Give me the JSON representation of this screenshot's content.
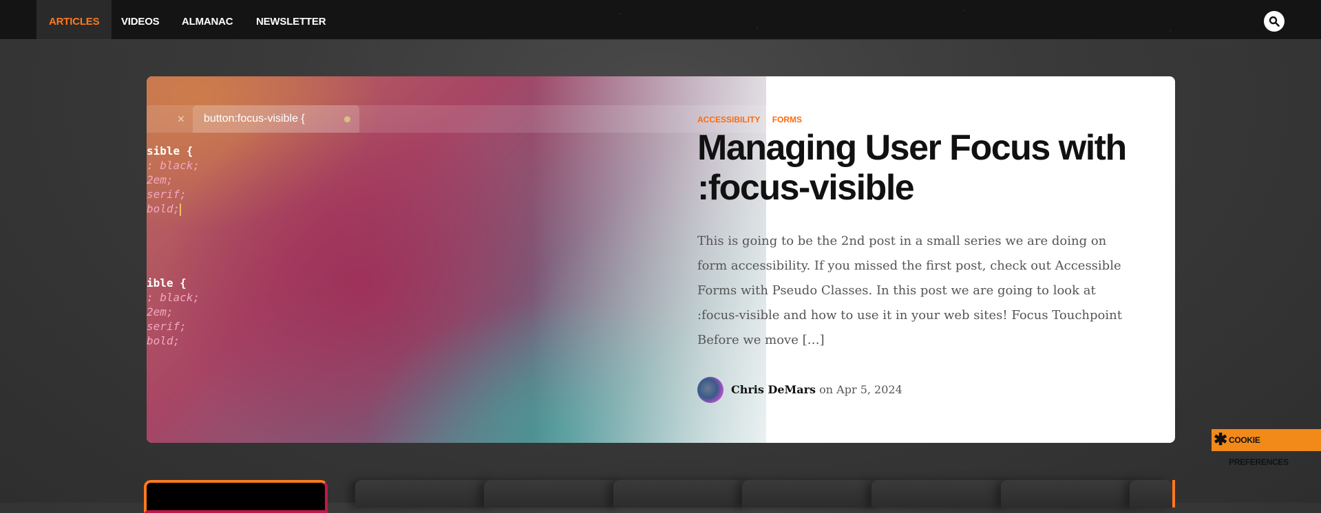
{
  "nav": {
    "items": [
      {
        "label": "ARTICLES",
        "active": true
      },
      {
        "label": "VIDEOS",
        "active": false
      },
      {
        "label": "ALMANAC",
        "active": false
      },
      {
        "label": "NEWSLETTER",
        "active": false
      }
    ],
    "search_icon": "search-icon"
  },
  "hero": {
    "image": {
      "tab_label": "button:focus-visible {",
      "code_block_1": [
        {
          "text": "sible {",
          "kind": "selector"
        },
        {
          "text": ": black;",
          "kind": "value"
        },
        {
          "text": "2em;",
          "kind": "value"
        },
        {
          "text": "serif;",
          "kind": "value"
        },
        {
          "text": "bold;",
          "kind": "value"
        }
      ],
      "code_block_2": [
        {
          "text": "ible {",
          "kind": "selector"
        },
        {
          "text": ": black;",
          "kind": "value"
        },
        {
          "text": "2em;",
          "kind": "value"
        },
        {
          "text": "serif;",
          "kind": "value"
        },
        {
          "text": "bold;",
          "kind": "value"
        }
      ]
    },
    "tags": [
      "ACCESSIBILITY",
      "FORMS"
    ],
    "title": "Managing User Focus with :focus-visible",
    "excerpt": "This is going to be the 2nd post in a small series we are doing on form accessibility. If you missed the first post, check out Accessible Forms with Pseudo Classes. In this post we are going to look at :focus-visible and how to use it in your web sites! Focus Touchpoint Before we move […]",
    "author": "Chris DeMars",
    "date_prefix": "on",
    "date": "Apr 5, 2024"
  },
  "cookie": {
    "label": "COOKIE PREFERENCES",
    "icon": "asterisk-icon"
  },
  "colors": {
    "accent": "#ff7a1f",
    "nav_bg": "#141414",
    "cookie_bg": "#f28a1a"
  }
}
